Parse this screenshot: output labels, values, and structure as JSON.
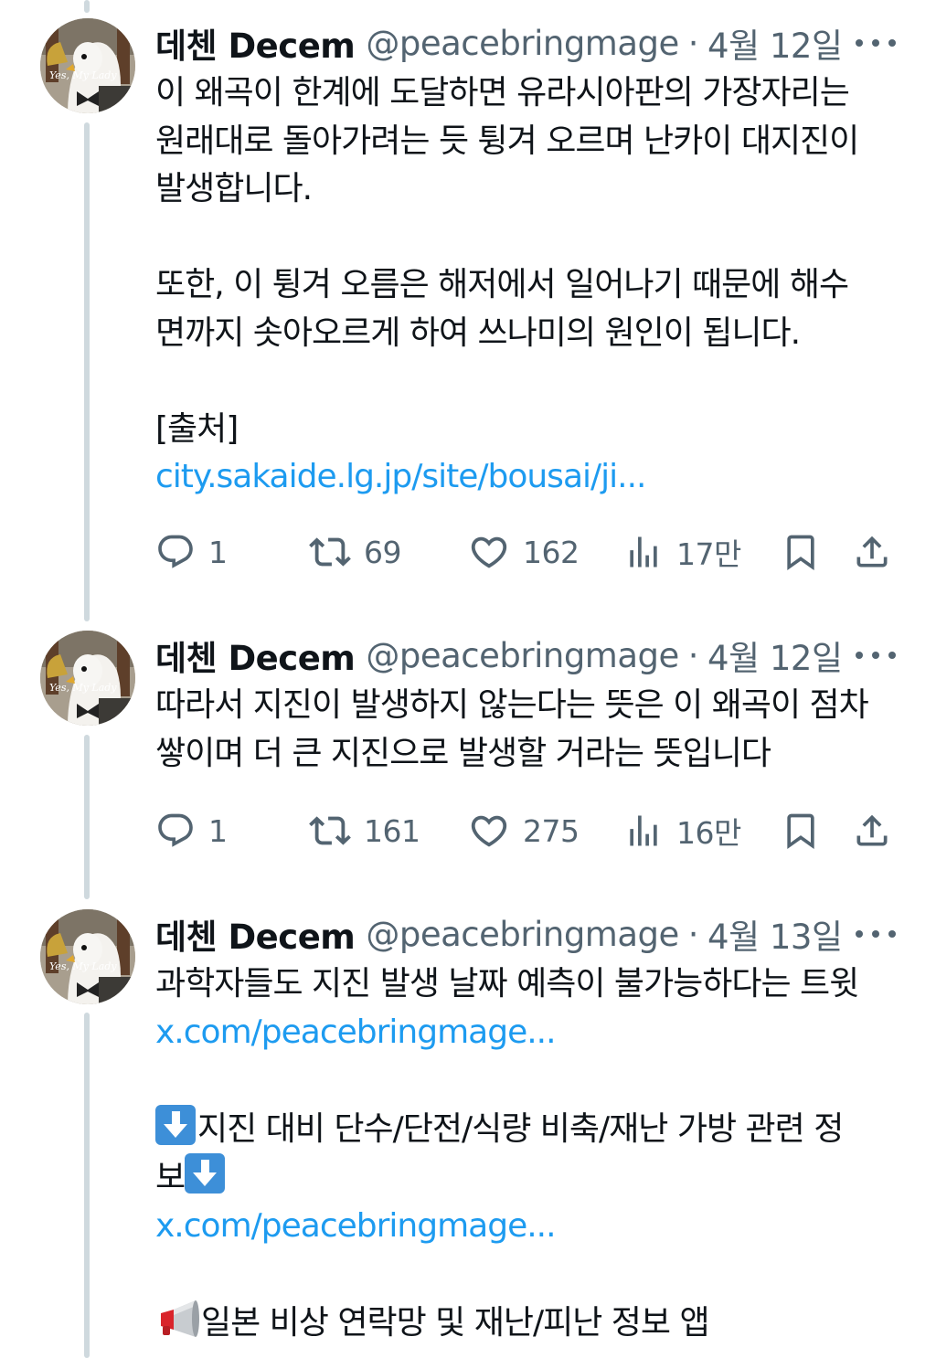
{
  "tweets": [
    {
      "author": "데첸 Decem",
      "handle": "@peacebringmage",
      "separator": "·",
      "date": "4월 12일",
      "paragraphs": [
        "이 왜곡이 한계에 도달하면 유라시아판의 가장자리는\n원래대로 돌아가려는 듯 튕겨 오르며 난카이 대지진이\n발생합니다.",
        "또한, 이 튕겨 오름은 해저에서 일어나기 때문에 해수\n면까지 솟아오르게 하여 쓰나미의 원인이 됩니다.",
        "[출처]"
      ],
      "link": "city.sakaide.lg.jp/site/bousai/ji...",
      "replies": "1",
      "reposts": "69",
      "likes": "162",
      "views": "17만"
    },
    {
      "author": "데첸 Decem",
      "handle": "@peacebringmage",
      "separator": "·",
      "date": "4월 12일",
      "paragraphs": [
        "따라서 지진이 발생하지 않는다는 뜻은 이 왜곡이 점차\n쌓이며 더 큰 지진으로 발생할 거라는 뜻입니다"
      ],
      "replies": "1",
      "reposts": "161",
      "likes": "275",
      "views": "16만"
    },
    {
      "author": "데첸 Decem",
      "handle": "@peacebringmage",
      "separator": "·",
      "date": "4월 13일",
      "line1": "과학자들도 지진 발생 날짜 예측이 불가능하다는 트윗",
      "link1": "x.com/peacebringmage...",
      "line2a": "지진 대비 단수/단전/식량 비축/재난 가방 관련 정",
      "line2b": "보",
      "link2": "x.com/peacebringmage...",
      "line3": "일본 비상 연락망 및 재난/피난 정보 앱"
    }
  ],
  "icons": {
    "more": "more-horizontal-icon",
    "reply": "reply-bubble-icon",
    "repost": "repost-arrows-icon",
    "like": "heart-icon",
    "views": "bar-chart-icon",
    "bookmark": "bookmark-icon",
    "share": "share-upload-icon",
    "emoji_arrow": "down-arrow-emoji",
    "emoji_megaphone": "megaphone-emoji"
  },
  "colors": {
    "link": "#1d9bf0",
    "secondary_text": "#536471",
    "thread_line": "#cfd9de"
  }
}
